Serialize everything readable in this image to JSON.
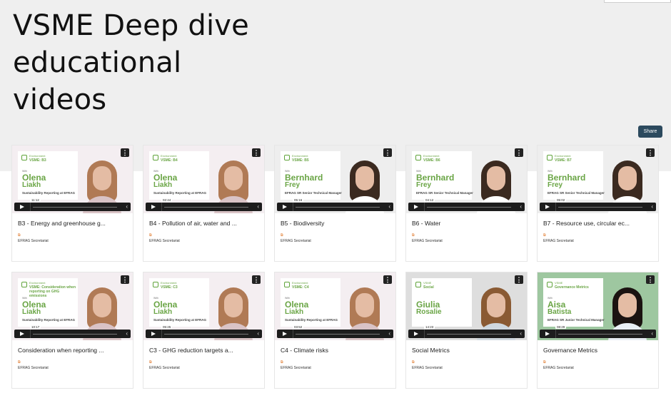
{
  "page": {
    "title_lines": [
      "VSME Deep dive",
      "educational",
      "videos"
    ],
    "share_label": "Share",
    "menu_glyph": "⋮",
    "chevron_glyph": "‹",
    "tag_glyph": "⧉"
  },
  "colors": {
    "accent_green": "#6aa545",
    "share_bg": "#2c4a5e",
    "hero_bg": "#efefef"
  },
  "videos": [
    {
      "title": "B3 - Energy and greenhouse g...",
      "author": "EFRAG Secretariat",
      "time": "11:12",
      "slide": {
        "cat": "Environment",
        "code": "VSME: B3",
        "with": "With",
        "first": "Olena",
        "last": "Liakh",
        "role": "Sustainability Reporting at EFRAG"
      }
    },
    {
      "title": "B4 - Pollution of air, water and ...",
      "author": "EFRAG Secretariat",
      "time": "02:44",
      "slide": {
        "cat": "Environment",
        "code": "VSME: B4",
        "with": "With",
        "first": "Olena",
        "last": "Liakh",
        "role": "Sustainability Reporting at EFRAG"
      }
    },
    {
      "title": "B5 - Biodiversity",
      "author": "EFRAG Secretariat",
      "time": "05:16",
      "slide": {
        "cat": "Environment",
        "code": "VSME: B5",
        "with": "With",
        "first": "Bernhard",
        "last": "Frey",
        "role": "EFRAG SR Senior Technical Manager"
      }
    },
    {
      "title": "B6 - Water",
      "author": "EFRAG Secretariat",
      "time": "04:12",
      "slide": {
        "cat": "Environment",
        "code": "VSME: B6",
        "with": "With",
        "first": "Bernhard",
        "last": "Frey",
        "role": "EFRAG SR Senior Technical Manager"
      }
    },
    {
      "title": "B7 - Resource use, circular ec...",
      "author": "EFRAG Secretariat",
      "time": "05:02",
      "slide": {
        "cat": "Environment",
        "code": "VSME: B7",
        "with": "With",
        "first": "Bernhard",
        "last": "Frey",
        "role": "EFRAG SR Senior Technical Manager"
      }
    },
    {
      "title": "Consideration when reporting ...",
      "author": "EFRAG Secretariat",
      "time": "10:17",
      "slide": {
        "cat": "Environment",
        "code": "VSME: Consideration when reporting on GHG emissions",
        "with": "With",
        "first": "Olena",
        "last": "Liakh",
        "role": "Sustainability Reporting at EFRAG"
      }
    },
    {
      "title": "C3 - GHG reduction targets a...",
      "author": "EFRAG Secretariat",
      "time": "05:25",
      "slide": {
        "cat": "Environment",
        "code": "VSME: C3",
        "with": "With",
        "first": "Olena",
        "last": "Liakh",
        "role": "Sustainability Reporting at EFRAG"
      }
    },
    {
      "title": "C4 - Climate risks",
      "author": "EFRAG Secretariat",
      "time": "03:52",
      "slide": {
        "cat": "Environment",
        "code": "VSME: C4",
        "with": "With",
        "first": "Olena",
        "last": "Liakh",
        "role": "Sustainability Reporting at EFRAG"
      }
    },
    {
      "title": "Social Metrics",
      "author": "EFRAG Secretariat",
      "time": "14:23",
      "slide": {
        "cat": "VSME",
        "code": "Social",
        "with": "",
        "first": "Giulia",
        "last": "Rosalie",
        "role": ""
      }
    },
    {
      "title": "Governance Metrics",
      "author": "EFRAG Secretariat",
      "time": "08:29",
      "slide": {
        "cat": "VSME",
        "code": "Governance Metrics",
        "with": "With",
        "first": "Aisa",
        "last": "Batista",
        "role": "EFRAG SR Junior Technical Manager"
      }
    }
  ]
}
